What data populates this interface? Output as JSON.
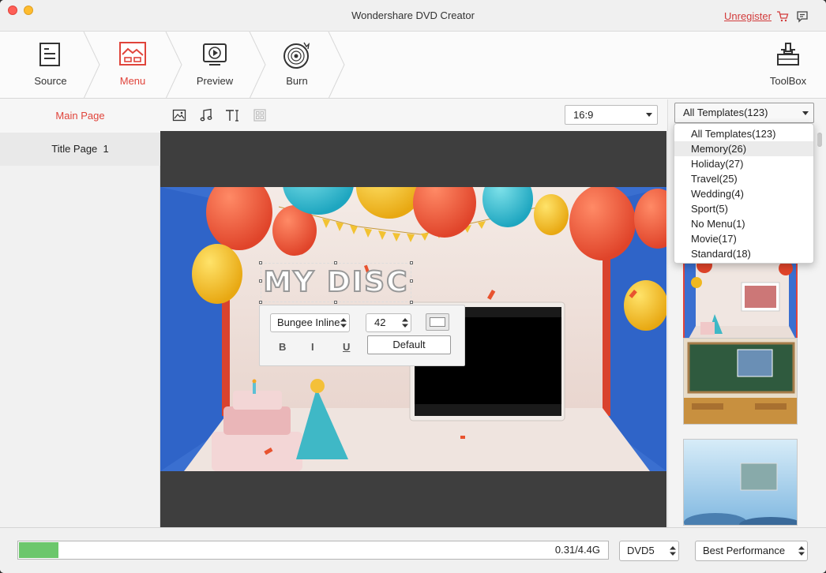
{
  "window": {
    "title": "Wondershare DVD Creator",
    "unregister_label": "Unregister"
  },
  "toolbar": {
    "steps": [
      {
        "label": "Source"
      },
      {
        "label": "Menu"
      },
      {
        "label": "Preview"
      },
      {
        "label": "Burn"
      }
    ],
    "active_step": "Menu",
    "toolbox_label": "ToolBox"
  },
  "left_panel": {
    "main_page_label": "Main Page",
    "title_page_label": "Title Page",
    "title_page_index": "1"
  },
  "preview": {
    "aspect_ratio": "16:9",
    "disc_title": "MY DISC",
    "font_name": "Bungee Inline",
    "font_size": "42",
    "bold_label": "B",
    "italic_label": "I",
    "underline_label": "U",
    "default_label": "Default"
  },
  "templates": {
    "selected": "All Templates(123)",
    "options": [
      "All Templates(123)",
      "Memory(26)",
      "Holiday(27)",
      "Travel(25)",
      "Wedding(4)",
      "Sport(5)",
      "No Menu(1)",
      "Movie(17)",
      "Standard(18)"
    ],
    "highlighted": "Memory(26)"
  },
  "bottom": {
    "progress_fraction": 0.067,
    "size_text": "0.31/4.4G",
    "disc_type": "DVD5",
    "quality": "Best Performance"
  },
  "colors": {
    "accent": "#e0443b",
    "progress": "#6cc76c"
  }
}
